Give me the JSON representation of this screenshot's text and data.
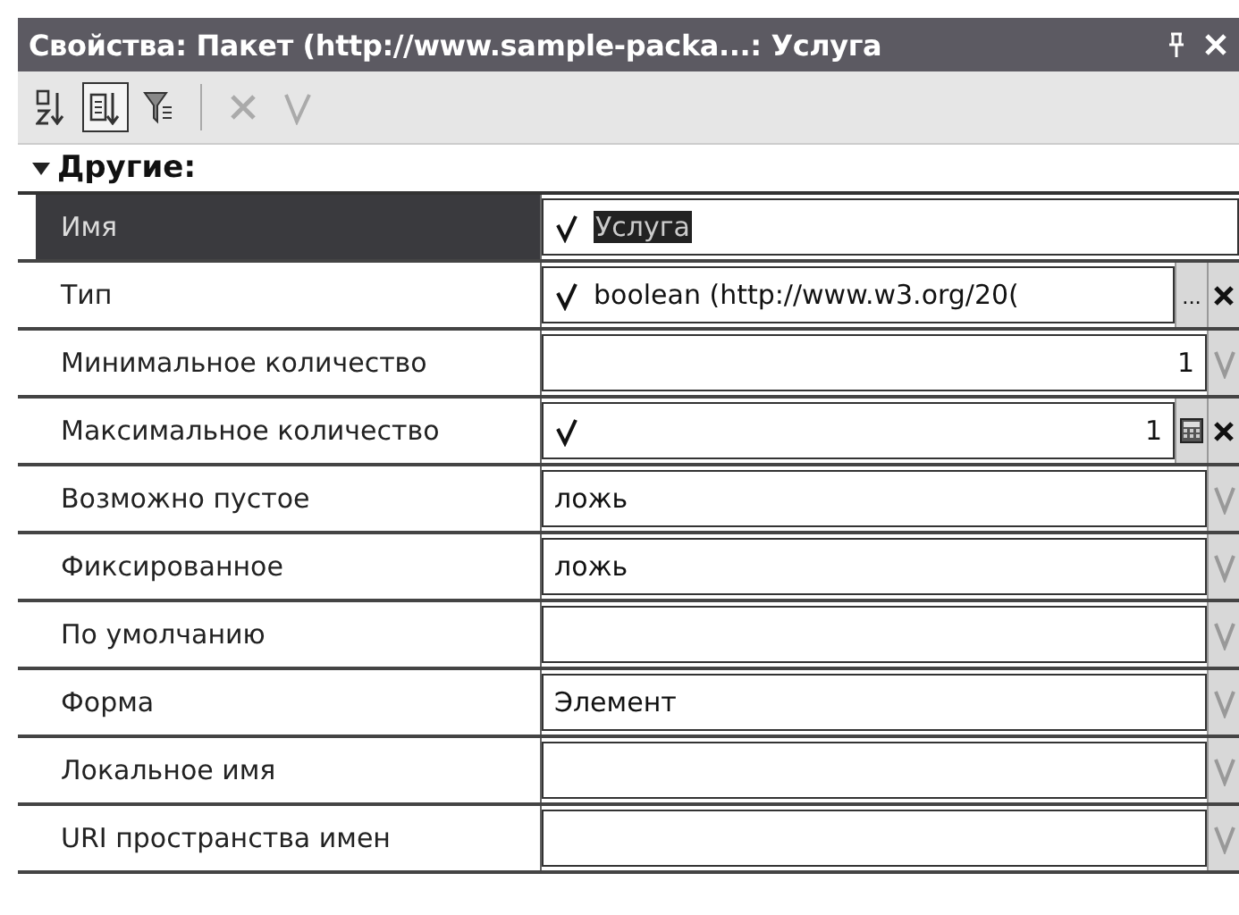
{
  "window": {
    "title": "Свойства: Пакет (http://www.sample-packa...: Услуга"
  },
  "toolbar": [
    {
      "kind": "sort",
      "pressed": false
    },
    {
      "kind": "categories",
      "pressed": true
    },
    {
      "kind": "filter",
      "pressed": false
    },
    {
      "kind": "separator"
    },
    {
      "kind": "cancel",
      "pressed": false,
      "disabled": true
    },
    {
      "kind": "accept",
      "pressed": false,
      "disabled": true
    }
  ],
  "group": {
    "title": "Другие:",
    "expanded": true
  },
  "rows": [
    {
      "label": "Имя",
      "selected": true,
      "set": true,
      "kind": "text",
      "value": "Услуга",
      "highlighted": true,
      "buttons": []
    },
    {
      "label": "Тип",
      "selected": false,
      "set": true,
      "kind": "text",
      "value": "boolean (http://www.w3.org/20(",
      "buttons": [
        {
          "kind": "ellipsis",
          "text": "...",
          "disabled": false
        },
        {
          "kind": "clear",
          "disabled": false
        }
      ]
    },
    {
      "label": "Минимальное количество",
      "selected": false,
      "set": false,
      "kind": "number",
      "value": "1",
      "buttons": [
        {
          "kind": "accept",
          "disabled": true
        }
      ]
    },
    {
      "label": "Максимальное количество",
      "selected": false,
      "set": true,
      "kind": "number",
      "value": "1",
      "buttons": [
        {
          "kind": "calculator",
          "disabled": false
        },
        {
          "kind": "clear",
          "disabled": false
        }
      ]
    },
    {
      "label": "Возможно пустое",
      "selected": false,
      "set": false,
      "kind": "text",
      "value": "ложь",
      "buttons": [
        {
          "kind": "accept",
          "disabled": true
        }
      ]
    },
    {
      "label": "Фиксированное",
      "selected": false,
      "set": false,
      "kind": "text",
      "value": "ложь",
      "buttons": [
        {
          "kind": "accept",
          "disabled": true
        }
      ]
    },
    {
      "label": "По умолчанию",
      "selected": false,
      "set": false,
      "kind": "text",
      "buttons": [
        {
          "kind": "accept",
          "disabled": true
        }
      ]
    },
    {
      "label": "Форма",
      "selected": false,
      "set": false,
      "kind": "text",
      "value": "Элемент",
      "buttons": [
        {
          "kind": "accept",
          "disabled": true
        }
      ]
    },
    {
      "label": "Локальное имя",
      "selected": false,
      "set": false,
      "kind": "text",
      "buttons": [
        {
          "kind": "accept",
          "disabled": true
        }
      ]
    },
    {
      "label": "URI пространства имен",
      "selected": false,
      "set": false,
      "kind": "text",
      "buttons": [
        {
          "kind": "accept",
          "disabled": true
        }
      ]
    }
  ]
}
